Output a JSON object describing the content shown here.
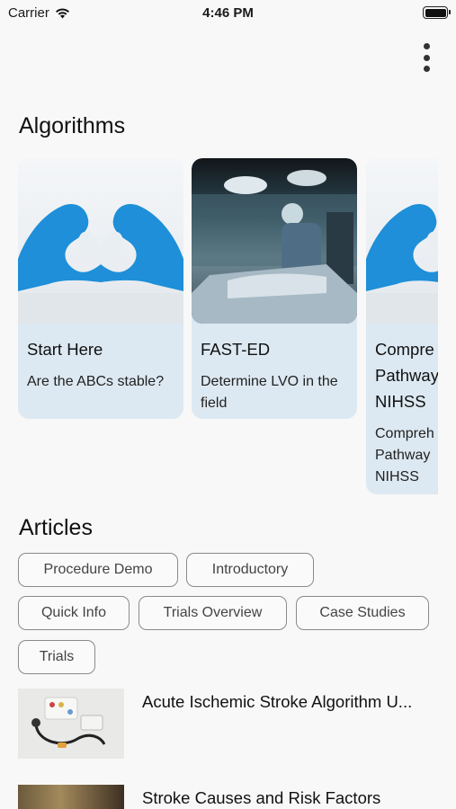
{
  "status_bar": {
    "carrier": "Carrier",
    "time": "4:46 PM"
  },
  "sections": {
    "algorithms": "Algorithms",
    "articles": "Articles"
  },
  "algorithms": [
    {
      "title": "Start Here",
      "description": "Are the ABCs stable?",
      "image": "blue-gloves-heart"
    },
    {
      "title": "FAST-ED",
      "description": "Determine LVO in the field",
      "image": "surgery-room"
    },
    {
      "title": "Comprehensive Pathway NIHSS",
      "description": "Comprehensive Pathway NIHSS",
      "image": "blue-gloves-heart"
    }
  ],
  "algorithm_cards": {
    "third_title_lines": [
      "Compre",
      "Pathway",
      "NIHSS"
    ],
    "third_desc_lines": [
      "Compreh",
      "Pathway",
      "NIHSS"
    ]
  },
  "filters": [
    "Procedure Demo",
    "Introductory",
    "Quick Info",
    "Trials Overview",
    "Case Studies",
    "Trials"
  ],
  "articles": [
    {
      "title": "Acute Ischemic Stroke Algorithm U...",
      "image": "stethoscope-pills"
    },
    {
      "title": "Stroke Causes and Risk Factors",
      "image": "clinic-photo"
    }
  ],
  "icons": {
    "wifi": "wifi-icon",
    "battery": "battery-icon",
    "menu": "more-vertical-icon"
  }
}
